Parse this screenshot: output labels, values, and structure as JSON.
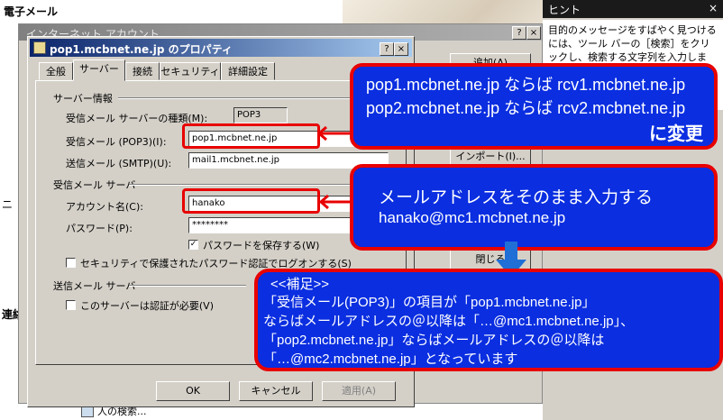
{
  "background": {
    "app_title": "電子メール",
    "left_fragment": "ニ",
    "contacts_label": "連絡先",
    "people_search": "人の検索..."
  },
  "hint_panel": {
    "title": "ヒント",
    "close": "×",
    "body": "目的のメッセージをすばやく見つけるには、ツール バーの［検索］をクリックし、検索する文字列を入力します。送信者の名前など、件名に含まれる言葉を検索す"
  },
  "account_dialog": {
    "title": "インターネット アカウント",
    "help": "?",
    "close": "×",
    "add_button": "追加(A)",
    "import_button": "インポート(I)...",
    "close_button": "閉じる"
  },
  "properties_dialog": {
    "title": "pop1.mcbnet.ne.jp のプロパティ",
    "help": "?",
    "close": "×",
    "tabs": [
      "全般",
      "サーバー",
      "接続",
      "セキュリティ",
      "詳細設定"
    ],
    "server_info": {
      "heading": "サーバー情報",
      "incoming_type_label": "受信メール サーバーの種類(M):",
      "incoming_type_value": "POP3",
      "incoming_label": "受信メール (POP3)(I):",
      "incoming_value": "pop1.mcbnet.ne.jp",
      "outgoing_label": "送信メール (SMTP)(U):",
      "outgoing_value": "mail1.mcbnet.ne.jp"
    },
    "incoming_server": {
      "heading": "受信メール サーバー",
      "account_label": "アカウント名(C):",
      "account_value": "hanako",
      "password_label": "パスワード(P):",
      "password_value": "********",
      "remember_label": "パスワードを保存する(W)",
      "remember_checked": true,
      "spa_label": "セキュリティで保護されたパスワード認証でログオンする(S)",
      "spa_checked": false
    },
    "outgoing_server": {
      "heading": "送信メール サーバー",
      "auth_label": "このサーバーは認証が必要(V)",
      "auth_checked": false
    },
    "buttons": {
      "ok": "OK",
      "cancel": "キャンセル",
      "apply": "適用(A)"
    }
  },
  "annotations": {
    "server_change": {
      "line1": "pop1.mcbnet.ne.jp ならば rcv1.mcbnet.ne.jp",
      "line2": "pop2.mcbnet.ne.jp ならば rcv2.mcbnet.ne.jp",
      "line3": "に変更"
    },
    "account_hint": {
      "line1": "メールアドレスをそのまま入力する",
      "line2": "hanako@mc1.mcbnet.ne.jp"
    },
    "supplement": {
      "heading": "<<補足>>",
      "line1": "「受信メール(POP3)」の項目が「pop1.mcbnet.ne.jp」",
      "line2": "ならばメールアドレスの＠以降は「…@mc1.mcbnet.ne.jp」、",
      "line3": "「pop2.mcbnet.ne.jp」ならばメールアドレスの＠以降は",
      "line4": "「…@mc2.mcbnet.ne.jp」となっています"
    }
  },
  "colors": {
    "callout_fill": "#0a2ee0",
    "callout_border": "#e80000",
    "arrow": "#1f6fd6"
  }
}
